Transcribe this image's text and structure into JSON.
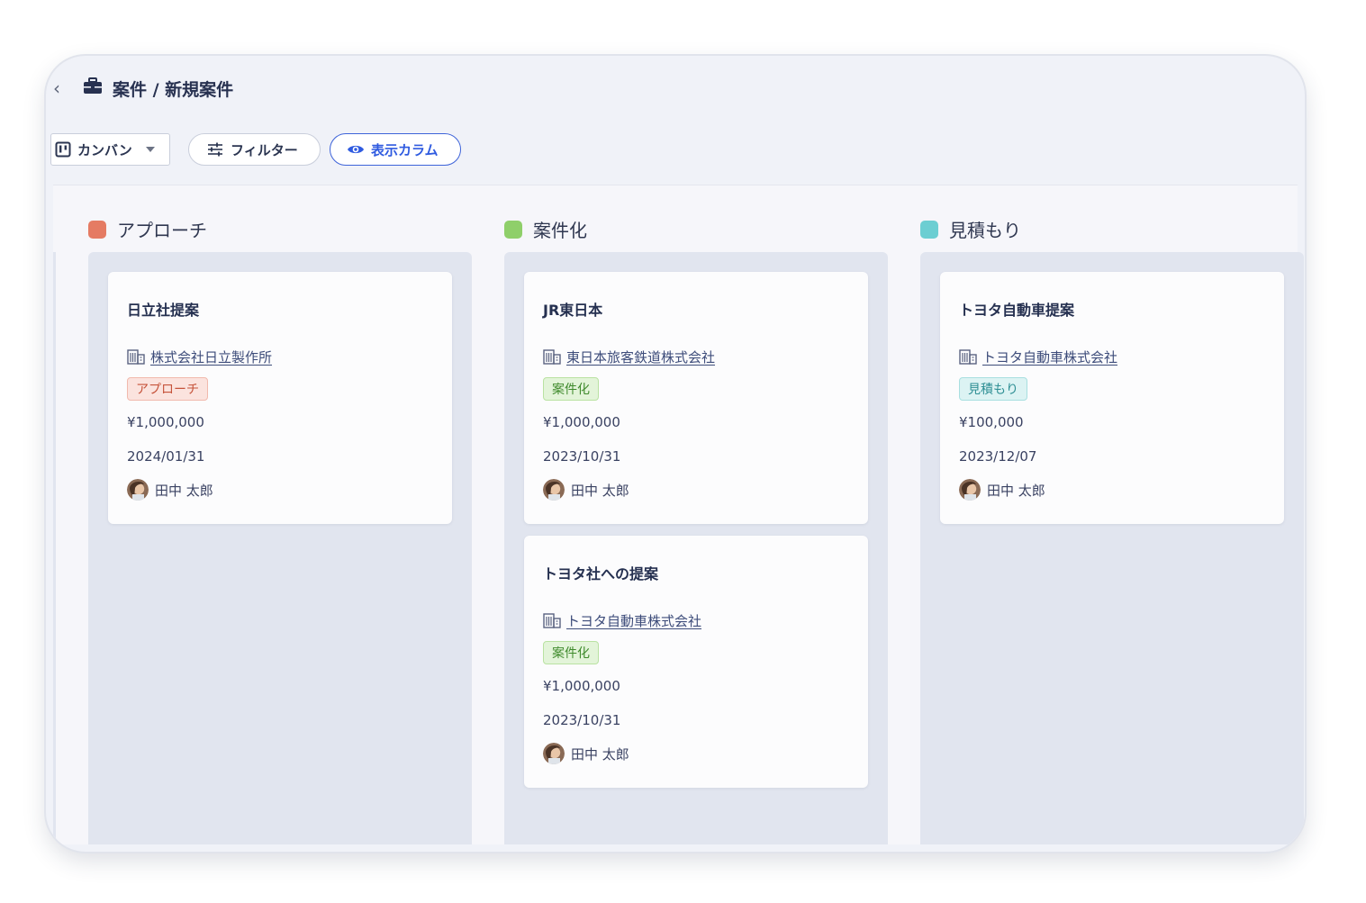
{
  "header": {
    "back_icon": "chevron-left-icon",
    "section_icon": "briefcase-icon",
    "breadcrumb": "案件 / 新規案件"
  },
  "toolbar": {
    "view_label": "カンバン",
    "filter_label": "フィルター",
    "columns_label": "表示カラム"
  },
  "colors": {
    "approach": "#e57b63",
    "case": "#8fcf6a",
    "estimate": "#6cced2",
    "accent": "#2f5be0"
  },
  "columns": [
    {
      "title": "アプローチ",
      "cards": [
        {
          "title": "日立社提案",
          "company": "株式会社日立製作所",
          "tag": "アプローチ",
          "amount": "¥1,000,000",
          "date": "2024/01/31",
          "person": "田中 太郎"
        }
      ]
    },
    {
      "title": "案件化",
      "cards": [
        {
          "title": "JR東日本",
          "company": "東日本旅客鉄道株式会社",
          "tag": "案件化",
          "amount": "¥1,000,000",
          "date": "2023/10/31",
          "person": "田中 太郎"
        },
        {
          "title": "トヨタ社への提案",
          "company": "トヨタ自動車株式会社",
          "tag": "案件化",
          "amount": "¥1,000,000",
          "date": "2023/10/31",
          "person": "田中 太郎"
        }
      ]
    },
    {
      "title": "見積もり",
      "cards": [
        {
          "title": "トヨタ自動車提案",
          "company": "トヨタ自動車株式会社",
          "tag": "見積もり",
          "amount": "¥100,000",
          "date": "2023/12/07",
          "person": "田中 太郎"
        }
      ]
    }
  ]
}
